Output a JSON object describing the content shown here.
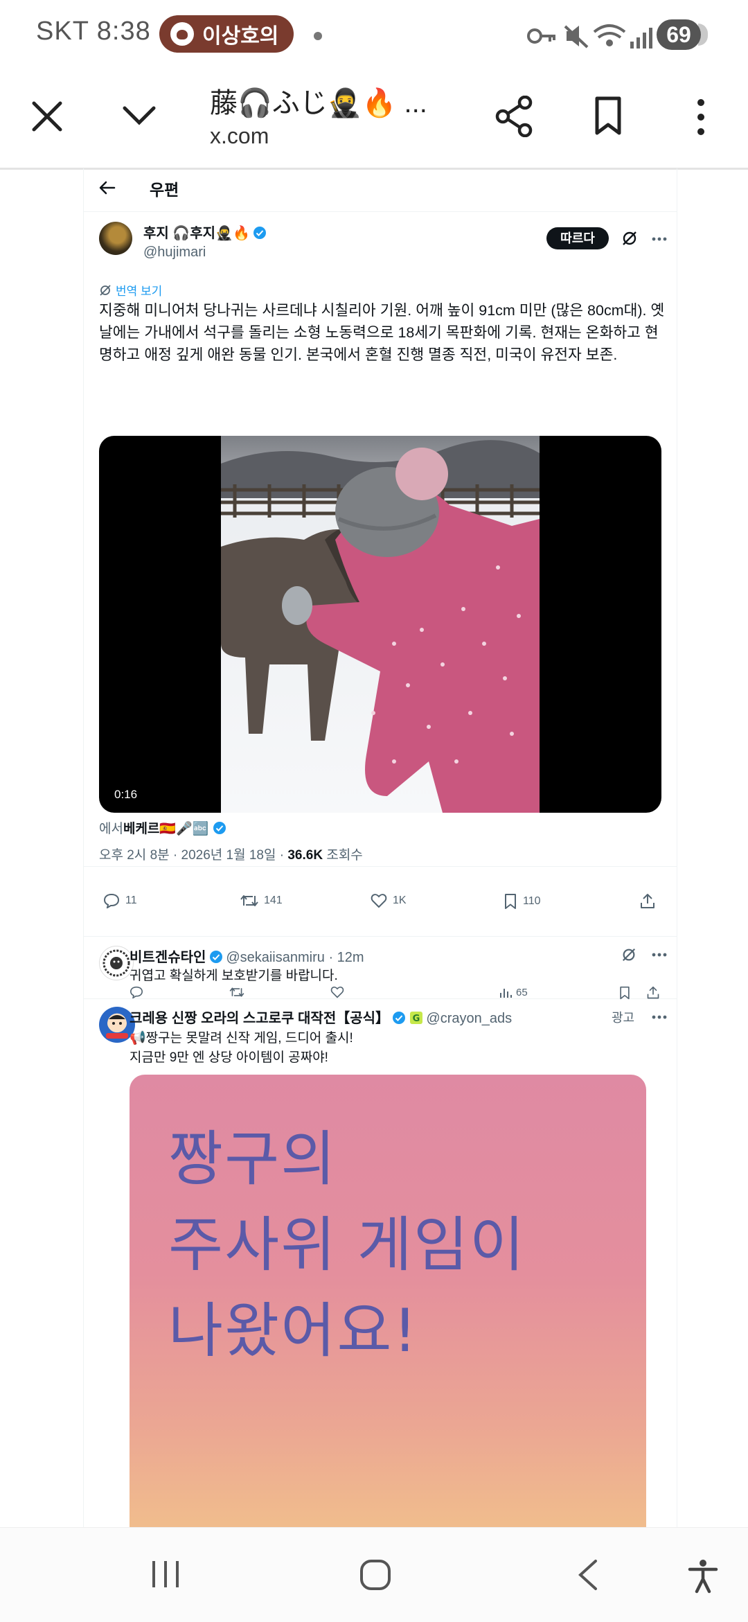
{
  "status_bar": {
    "carrier": "SKT",
    "time": "8:38",
    "notification_pill": "이상호의",
    "battery": "69"
  },
  "browser": {
    "tab_title": "藤🎧ふじ🥷🔥 ...",
    "url": "x.com"
  },
  "page": {
    "back_label": "우편"
  },
  "post": {
    "display_name": "후지 🎧후지🥷🔥",
    "handle": "@hujimari",
    "follow_label": "따르다",
    "translate_label": "번역 보기",
    "text": "지중해 미니어처 당나귀는 사르데냐 시칠리아 기원. 어깨 높이 91cm 미만 (많은 80cm대). 옛날에는 가내에서 석구를 돌리는 소형 노동력으로 18세기 목판화에 기록. 현재는 온화하고 현명하고 애정 깊게 애완 동물 인기. 본국에서 혼혈 진행 멸종 직전, 미국이 유전자 보존.",
    "video_duration": "0:16",
    "source_prefix": "에서",
    "source_name": "베케르🇪🇸🎤🔤",
    "timestamp": "오후 2시 8분 · 2026년 1월 18일 ·",
    "views_count": "36.6K",
    "views_label": "조회수",
    "replies": "11",
    "reposts": "141",
    "likes": "1K",
    "bookmarks": "110"
  },
  "reply": {
    "display_name": "비트겐슈타인",
    "handle": "@sekaiisanmiru · 12m",
    "text": "귀엽고 확실하게 보호받기를 바랍니다.",
    "views": "65"
  },
  "ad": {
    "display_name": "크레용 신짱 오라의 스고로쿠 대작전【공식】",
    "handle": "@crayon_ads",
    "ad_label": "광고",
    "line1": "📢짱구는 못말려 신작 게임, 드디어 출시!",
    "line2": "지금만 9만 엔 상당 아이템이 공짜야!",
    "image_text": [
      "짱구의",
      "주사위 게임이",
      "나왔어요!"
    ]
  }
}
